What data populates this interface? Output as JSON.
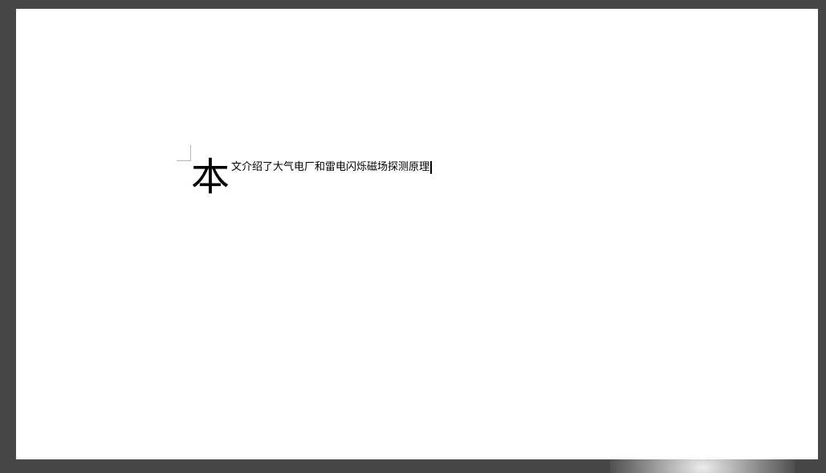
{
  "document": {
    "drop_cap": "本",
    "text": "文介绍了大气电厂和雷电闪烁磁场探测原理"
  }
}
